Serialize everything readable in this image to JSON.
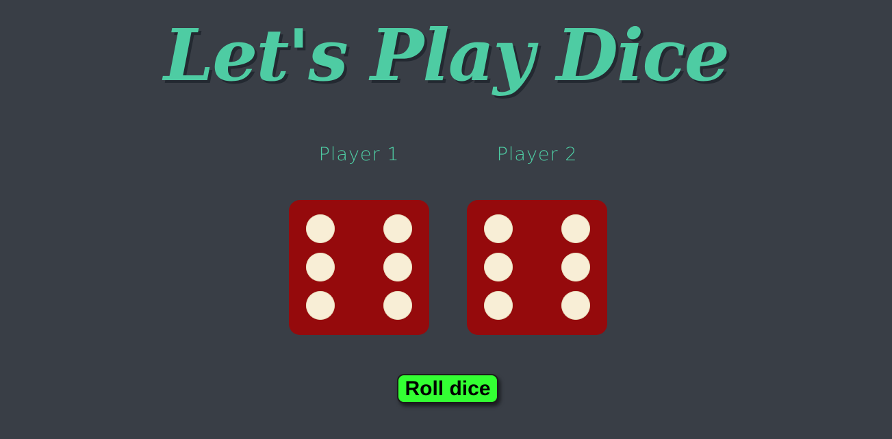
{
  "title": "Let's Play Dice",
  "players": [
    {
      "label": "Player 1",
      "die_value": 6
    },
    {
      "label": "Player 2",
      "die_value": 6
    }
  ],
  "roll_button_label": "Roll dice",
  "colors": {
    "background": "#393e46",
    "title": "#4ecca3",
    "die_face": "#950a0c",
    "pip": "#f8eed6",
    "button": "#33ff33"
  }
}
